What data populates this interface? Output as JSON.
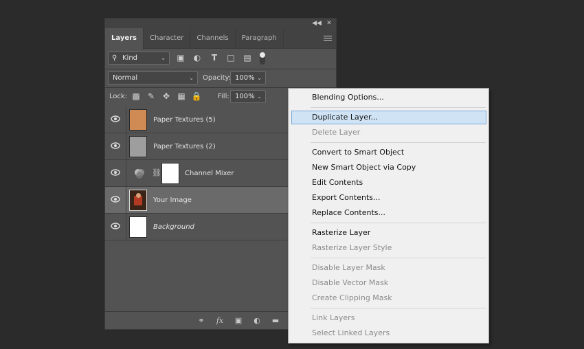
{
  "panel": {
    "tabs": [
      {
        "label": "Layers",
        "active": true
      },
      {
        "label": "Character",
        "active": false
      },
      {
        "label": "Channels",
        "active": false
      },
      {
        "label": "Paragraph",
        "active": false
      }
    ],
    "filter": {
      "kind_label": "Kind"
    },
    "blend_mode": "Normal",
    "opacity_label": "Opacity:",
    "opacity_value": "100%",
    "lock_label": "Lock:",
    "fill_label": "Fill:",
    "fill_value": "100%",
    "layers": [
      {
        "name": "Paper Textures (5)",
        "thumb_color": "#d08b54",
        "selected": false
      },
      {
        "name": "Paper Textures (2)",
        "thumb_color": "#9e9e9e",
        "selected": false
      },
      {
        "name": "Channel Mixer",
        "adjustment": true,
        "selected": false
      },
      {
        "name": "Your Image",
        "thumb_color": "#8a2a1c",
        "selected": true
      },
      {
        "name": "Background",
        "thumb_color": "#ffffff",
        "italic": true,
        "selected": false
      }
    ]
  },
  "context_menu": {
    "items": [
      {
        "label": "Blending Options...",
        "enabled": true
      },
      {
        "label": "Duplicate Layer...",
        "enabled": true,
        "highlighted": true
      },
      {
        "label": "Delete Layer",
        "enabled": false
      },
      {
        "label": "Convert to Smart Object",
        "enabled": true
      },
      {
        "label": "New Smart Object via Copy",
        "enabled": true
      },
      {
        "label": "Edit Contents",
        "enabled": true
      },
      {
        "label": "Export Contents...",
        "enabled": true
      },
      {
        "label": "Replace Contents...",
        "enabled": true
      },
      {
        "label": "Rasterize Layer",
        "enabled": true
      },
      {
        "label": "Rasterize Layer Style",
        "enabled": false
      },
      {
        "label": "Disable Layer Mask",
        "enabled": false
      },
      {
        "label": "Disable Vector Mask",
        "enabled": false
      },
      {
        "label": "Create Clipping Mask",
        "enabled": false
      },
      {
        "label": "Link Layers",
        "enabled": false
      },
      {
        "label": "Select Linked Layers",
        "enabled": false
      }
    ]
  },
  "icons": {
    "collapse": "double-chevron-left-icon",
    "close": "close-icon",
    "panel_menu": "hamburger-menu-icon",
    "search": "search-icon",
    "footer": [
      "link-icon",
      "fx-icon",
      "mask-icon",
      "adjustment-icon",
      "folder-icon"
    ]
  }
}
